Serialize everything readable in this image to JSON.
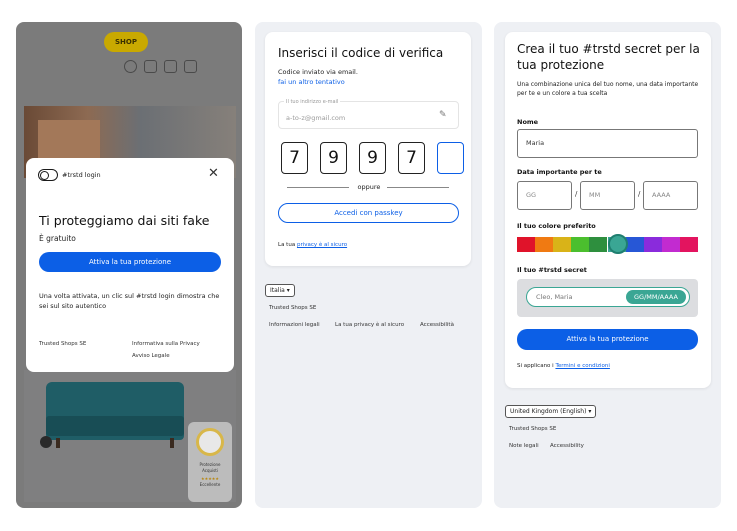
{
  "panel1": {
    "shop_logo": "SHOP",
    "modal": {
      "brand": "#trstd login",
      "close_icon": "✕",
      "title": "Ti proteggiamo dai siti fake",
      "subtitle": "È gratuito",
      "cta": "Attiva la tua protezione",
      "description": "Una volta attivata, un clic sul #trstd login dimostra che sei sul sito autentico",
      "footer_company": "Trusted Shops SE",
      "footer_privacy": "Informativa sulla Privacy",
      "footer_legal": "Avviso Legale"
    }
  },
  "panel2": {
    "title": "Inserisci il codice di verifica",
    "sent_note": "Codice inviato via email.",
    "retry_link": "fai un altro tentativo",
    "email_label": "Il tuo indirizzo e-mail",
    "email_value": "a-to-z@gmail.com",
    "code_digits": [
      "7",
      "9",
      "9",
      "7",
      ""
    ],
    "or_text": "oppure",
    "passkey_button": "Accedi con passkey",
    "privacy_prefix": "La tua ",
    "privacy_link": "privacy è al sicuro",
    "language": "Italia ▾",
    "footer_company": "Trusted Shops SE",
    "footer_legal": "Informazioni legali",
    "footer_privacy": "La tua privacy è al sicuro",
    "footer_accessibility": "Accessibilità"
  },
  "panel3": {
    "title": "Crea il tuo #trstd secret per la tua protezione",
    "intro": "Una combinazione unica del tuo nome, una data importante per te e un colore a tua scelta",
    "name_label": "Nome",
    "name_value": "Maria",
    "date_label": "Data importante per te",
    "day_placeholder": "GG",
    "month_placeholder": "MM",
    "year_placeholder": "AAAA",
    "date_separator": "/",
    "color_label": "Il tuo colore preferito",
    "colors": [
      "#e0132a",
      "#f07a12",
      "#d9b318",
      "#4bbf2e",
      "#2e8f3e",
      "#3aa694",
      "#2757d6",
      "#8a2bdc",
      "#c22bd0",
      "#e3145f"
    ],
    "selected_color": "#3aa694",
    "secret_label": "Il tuo #trstd secret",
    "secret_name": "Cleo, Maria",
    "secret_date": "GG/MM/AAAA",
    "cta": "Attiva la tua protezione",
    "terms_prefix": "Si applicano i ",
    "terms_link": "Termini e condizioni",
    "language": "United Kingdom (English) ▾",
    "footer_company": "Trusted Shops SE",
    "footer_legal": "Note legali",
    "footer_accessibility": "Accessibility"
  },
  "colors": {
    "primary": "#0c5fe6",
    "overlay": "#7b7b7b",
    "panel_bg": "#eef0f4"
  }
}
